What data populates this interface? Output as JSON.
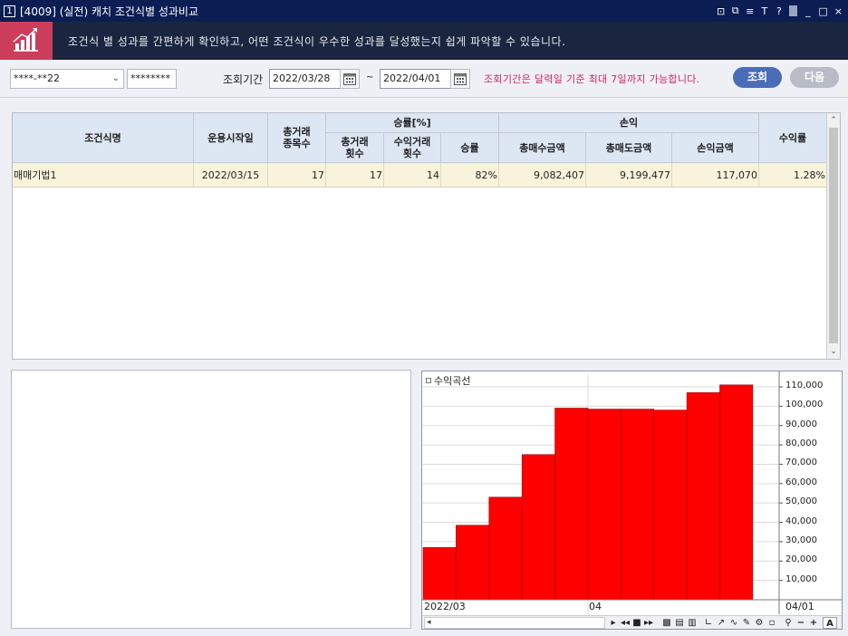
{
  "titlebar": {
    "window_num": "1",
    "title": "[4009] (실전) 캐치 조건식별 성과비교",
    "controls": [
      "⊡",
      "⧉",
      "≡",
      "T",
      "?",
      "_",
      "□",
      "×"
    ]
  },
  "banner": {
    "message": "조건식 별 성과를 간편하게 확인하고, 어떤 조건식이 우수한 성과를 달성했는지 쉽게 파악할 수 있습니다."
  },
  "toolbar": {
    "account": "****-**22",
    "password": "********",
    "period_label": "조회기간",
    "start_date": "2022/03/28",
    "tilde": "~",
    "end_date": "2022/04/01",
    "notice": "조회기간은 달력일 기준 최대 7일까지 가능합니다.",
    "search_label": "조회",
    "next_label": "다음",
    "colors": {
      "search_btn": "#4a6db8",
      "next_btn": "#b7bcc7",
      "notice": "#d4246a"
    }
  },
  "grid": {
    "headers": {
      "condition": "조건식명",
      "start": "운용시작일",
      "total_items": "총거래\n종목수",
      "winrate_group": "승률[%]",
      "total_trades": "총거래\n횟수",
      "profit_trades": "수익거래\n횟수",
      "winrate": "승률",
      "pnl_group": "손익",
      "total_buy": "총매수금액",
      "total_sell": "총매도금액",
      "pnl_amount": "손익금액",
      "return": "수익률"
    },
    "rows": [
      {
        "condition": "매매기법1",
        "start": "2022/03/15",
        "total_items": "17",
        "total_trades": "17",
        "profit_trades": "14",
        "winrate": "82%",
        "total_buy": "9,082,407",
        "total_sell": "9,199,477",
        "pnl_amount": "117,070",
        "return": "1.28%"
      }
    ]
  },
  "chart": {
    "legend": "수익곡선",
    "bar_color": "#ff0000",
    "x_labels": [
      "2022/03",
      "04",
      "04/01"
    ],
    "y_ticks": [
      "110,000",
      "100,000",
      "90,000",
      "80,000",
      "70,000",
      "60,000",
      "50,000",
      "40,000",
      "30,000",
      "20,000",
      "10,000"
    ]
  },
  "chart_data": {
    "type": "bar",
    "title": "수익곡선",
    "values": [
      27000,
      38500,
      53000,
      75000,
      99000,
      98500,
      98500,
      98000,
      107000,
      111000
    ],
    "ylim": [
      0,
      110000
    ],
    "y_ticks": [
      10000,
      20000,
      30000,
      40000,
      50000,
      60000,
      70000,
      80000,
      90000,
      100000,
      110000
    ],
    "grid": true
  }
}
